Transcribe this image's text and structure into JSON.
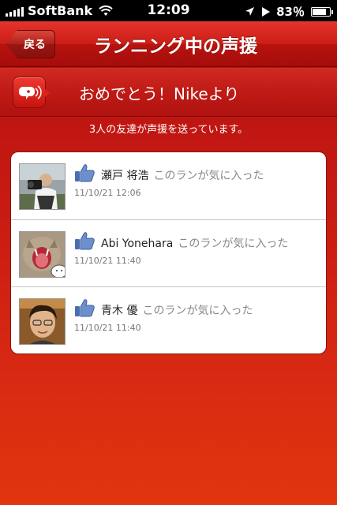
{
  "status_bar": {
    "carrier": "SoftBank",
    "time": "12:09",
    "battery_percent": "83％",
    "battery_level": 0.83,
    "icons": [
      "signal-icon",
      "wifi-icon",
      "location-icon",
      "play-icon",
      "battery-icon"
    ]
  },
  "nav": {
    "back_label": "戻る",
    "title": "ランニング中の声援"
  },
  "banner": {
    "icon": "cheer-speech-icon",
    "message": "おめでとう！Nikeより"
  },
  "friends_summary": "3人の友達が声援を送っています。",
  "cheers": [
    {
      "name": "瀬戸 将浩",
      "action": "このランが気に入った",
      "date": "11/10/21 12:06",
      "avatar": "avatar-photographer"
    },
    {
      "name": "Abi Yonehara",
      "action": "このランが気に入った",
      "date": "11/10/21 11:40",
      "avatar": "avatar-cat"
    },
    {
      "name": "青木 優",
      "action": "このランが気に入った",
      "date": "11/10/21 11:40",
      "avatar": "avatar-man-glasses"
    }
  ],
  "colors": {
    "nav_red": "#cd1d17",
    "background_red": "#c71a12",
    "like_blue": "#4a6fb0"
  }
}
